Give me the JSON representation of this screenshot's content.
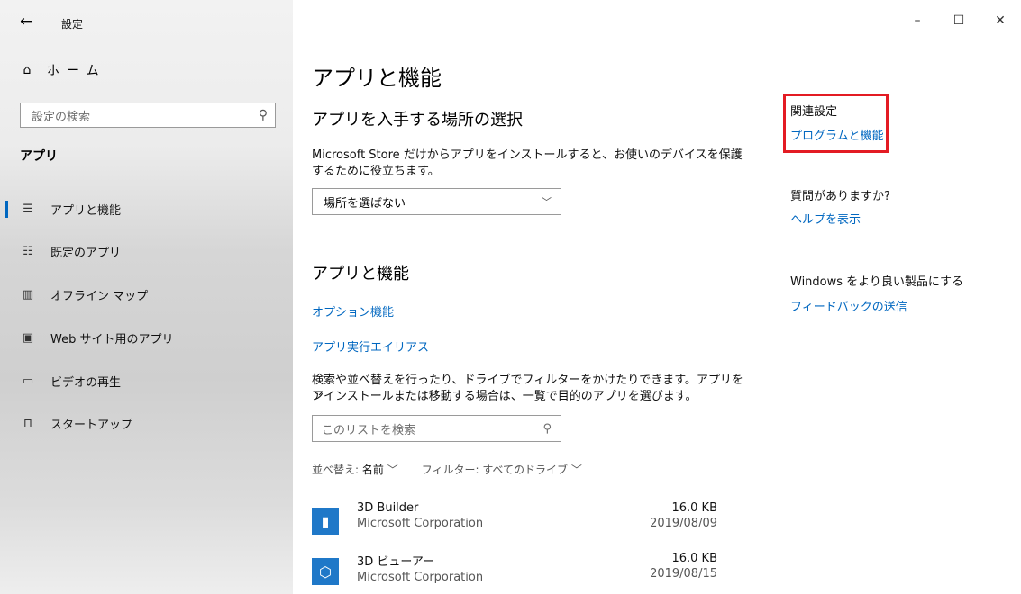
{
  "window": {
    "title": "設定",
    "back_glyph": "←",
    "controls": {
      "minimize": "–",
      "maximize": "☐",
      "close": "✕"
    }
  },
  "sidebar": {
    "home_label": "ホーム",
    "search_placeholder": "設定の検索",
    "section_label": "アプリ",
    "items": [
      {
        "label": "アプリと機能",
        "icon": "apps-features-icon",
        "glyph": "☰",
        "active": true
      },
      {
        "label": "既定のアプリ",
        "icon": "default-apps-icon",
        "glyph": "☷"
      },
      {
        "label": "オフライン マップ",
        "icon": "offline-maps-icon",
        "glyph": "▥"
      },
      {
        "label": "Web サイト用のアプリ",
        "icon": "apps-for-websites-icon",
        "glyph": "▣"
      },
      {
        "label": "ビデオの再生",
        "icon": "video-playback-icon",
        "glyph": "▭"
      },
      {
        "label": "スタートアップ",
        "icon": "startup-icon",
        "glyph": "⊓"
      }
    ]
  },
  "main": {
    "title": "アプリと機能",
    "choose_heading": "アプリを入手する場所の選択",
    "choose_desc1": "Microsoft Store だけからアプリをインストールすると、お使いのデバイスを保護",
    "choose_desc2": "するために役立ちます。",
    "location_select": "場所を選ばない",
    "apps_heading": "アプリと機能",
    "optional_features_link": "オプション機能",
    "app_alias_link": "アプリ実行エイリアス",
    "list_desc1": "検索や並べ替えを行ったり、ドライブでフィルターをかけたりできます。アプリをア",
    "list_desc2": "ンインストールまたは移動する場合は、一覧で目的のアプリを選びます。",
    "list_search_placeholder": "このリストを検索",
    "sort_label": "並べ替え:",
    "sort_value": "名前",
    "filter_label": "フィルター: すべてのドライブ",
    "apps": [
      {
        "name": "3D Builder",
        "publisher": "Microsoft Corporation",
        "size": "16.0 KB",
        "date": "2019/08/09",
        "icon": "3d-builder-icon"
      },
      {
        "name": "3D ビューアー",
        "publisher": "Microsoft Corporation",
        "size": "16.0 KB",
        "date": "2019/08/15",
        "icon": "3d-viewer-icon"
      }
    ]
  },
  "related": {
    "heading": "関連設定",
    "programs_link": "プログラムと機能",
    "question": "質問がありますか?",
    "help_link": "ヘルプを表示",
    "improve": "Windows をより良い製品にする",
    "feedback_link": "フィードバックの送信"
  },
  "colors": {
    "accent": "#0067c0",
    "highlight": "#e31b23",
    "tile": "#1f78c8"
  }
}
